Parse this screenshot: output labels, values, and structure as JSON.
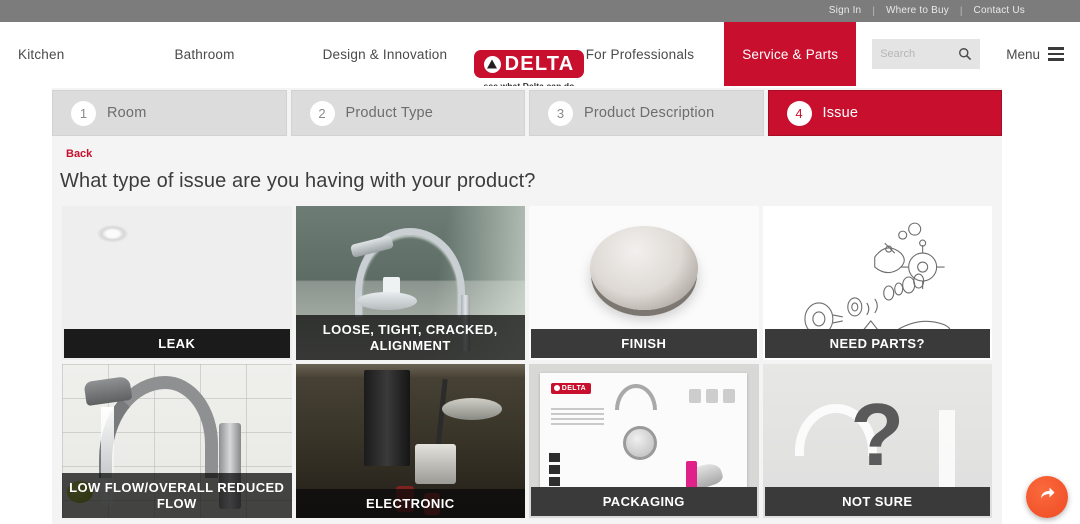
{
  "utility": {
    "links": [
      {
        "label": "Sign In"
      },
      {
        "label": "Where to Buy"
      },
      {
        "label": "Contact Us"
      }
    ],
    "separator": "|"
  },
  "header": {
    "nav_left": [
      {
        "label": "Kitchen"
      },
      {
        "label": "Bathroom"
      },
      {
        "label": "Design & Innovation"
      }
    ],
    "logo": {
      "wordmark": "DELTA",
      "tagline": "see what Delta can do",
      "icon": "delta-triangle-icon",
      "color": "#c8102e"
    },
    "pro_link": {
      "label": "For Professionals"
    },
    "service_tab": {
      "label": "Service & Parts",
      "active": true,
      "color": "#c8102e"
    },
    "search": {
      "value": "",
      "placeholder": "Search",
      "icon": "search-icon"
    },
    "menu": {
      "label": "Menu",
      "icon": "hamburger-icon"
    }
  },
  "stepper": {
    "steps": [
      {
        "number": "1",
        "label": "Room",
        "active": false
      },
      {
        "number": "2",
        "label": "Product Type",
        "active": false
      },
      {
        "number": "3",
        "label": "Product Description",
        "active": false
      },
      {
        "number": "4",
        "label": "Issue",
        "active": true
      }
    ],
    "active_color": "#c8102e",
    "inactive_color": "#dcdcdc"
  },
  "content": {
    "back_label": "Back",
    "heading": "What type of issue are you having with your product?"
  },
  "tiles": [
    {
      "label": "LEAK",
      "image": "water-droplets-image"
    },
    {
      "label": "LOOSE, TIGHT, CRACKED, ALIGNMENT",
      "image": "kitchen-faucet-sink-image"
    },
    {
      "label": "FINISH",
      "image": "metal-finish-puck-image"
    },
    {
      "label": "NEED PARTS?",
      "image": "exploded-parts-diagram-image"
    },
    {
      "label": "LOW FLOW/OVERALL REDUCED FLOW",
      "image": "running-faucet-image"
    },
    {
      "label": "ELECTRONIC",
      "image": "under-sink-electronics-image"
    },
    {
      "label": "PACKAGING",
      "image": "delta-packaging-sheet-image"
    },
    {
      "label": "NOT SURE",
      "image": "question-mark-image"
    }
  ],
  "fab": {
    "icon": "share-arrow-icon",
    "color": "#ef4a23"
  }
}
